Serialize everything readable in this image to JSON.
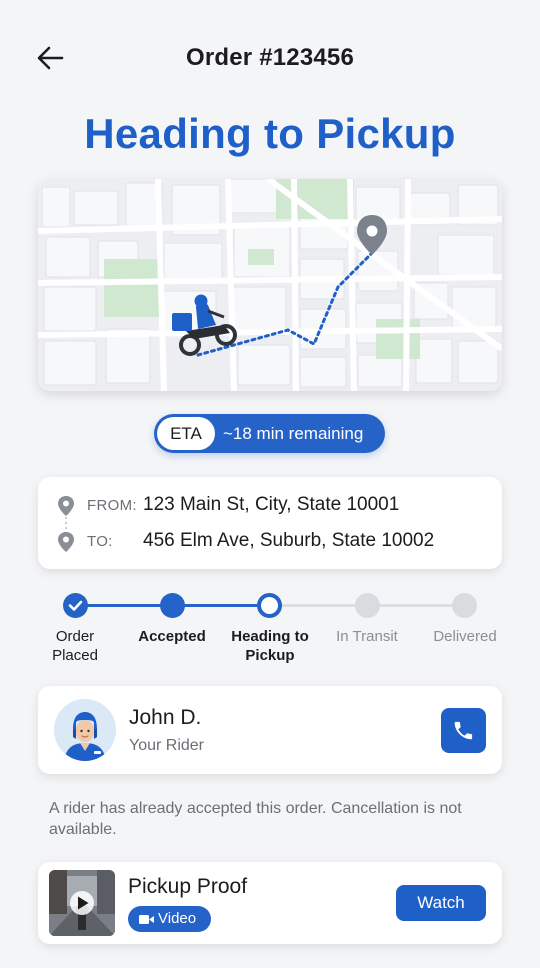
{
  "header": {
    "back_icon": "arrow-left-icon",
    "title": "Order #123456"
  },
  "status_heading": "Heading to Pickup",
  "map": {
    "rider_icon": "motorcycle-rider-icon",
    "destination_icon": "map-pin-icon",
    "route_color": "#1f5fc8"
  },
  "eta": {
    "tag": "ETA",
    "text": "~18 min remaining"
  },
  "addresses": {
    "from_label": "FROM:",
    "from_value": "123 Main St, City, State 10001",
    "to_label": "TO:",
    "to_value": "456 Elm Ave, Suburb, State 10002"
  },
  "steps": [
    {
      "label_line1": "Order",
      "label_line2": "Placed",
      "state": "done"
    },
    {
      "label_line1": "Accepted",
      "label_line2": "",
      "state": "done"
    },
    {
      "label_line1": "Heading to",
      "label_line2": "Pickup",
      "state": "current"
    },
    {
      "label_line1": "In Transit",
      "label_line2": "",
      "state": "pending"
    },
    {
      "label_line1": "Delivered",
      "label_line2": "",
      "state": "pending"
    }
  ],
  "rider": {
    "name": "John D.",
    "role": "Your Rider",
    "call_icon": "phone-icon"
  },
  "note": "A rider has already accepted this order. Cancellation is not available.",
  "proof": {
    "title": "Pickup Proof",
    "badge": "Video",
    "action": "Watch",
    "play_icon": "play-icon"
  },
  "colors": {
    "accent": "#1f5fc8",
    "accent_light": "#2563c9",
    "pending": "#d9dbe0"
  }
}
